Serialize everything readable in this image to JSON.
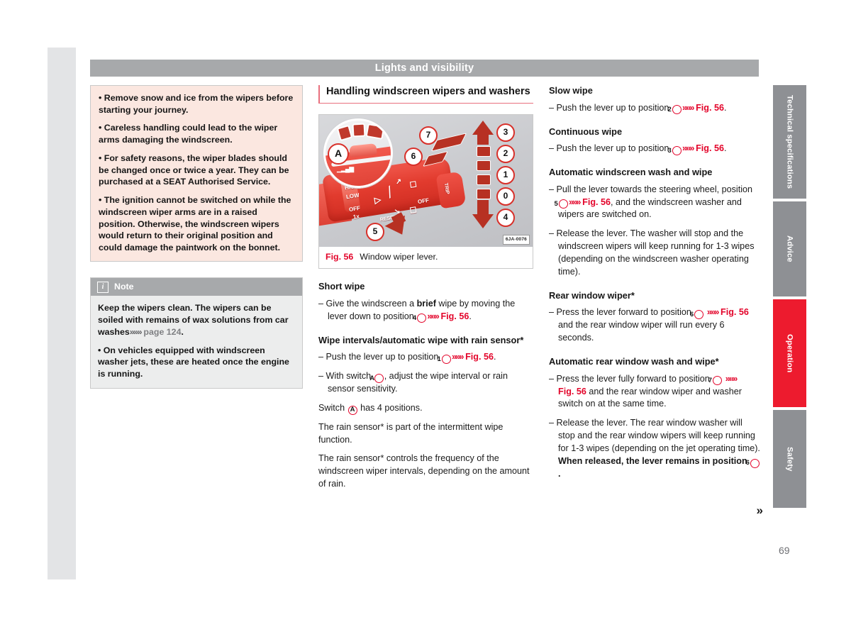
{
  "header": {
    "title": "Lights and visibility"
  },
  "page": {
    "number": "69",
    "continuation": "»"
  },
  "warning": {
    "items": [
      "• Remove snow and ice from the wipers before starting your journey.",
      "• Careless handling could lead to the wiper arms damaging the windscreen.",
      "• For safety reasons, the wiper blades should be changed once or twice a year. They can be purchased at a SEAT Authorised Service.",
      "• The ignition cannot be switched on while the windscreen wiper arms are in a raised position. Otherwise, the windscreen wipers would return to their original position and could damage the paintwork on the bonnet."
    ]
  },
  "note": {
    "icon": "info-icon",
    "title": "Note",
    "para1_a": "Keep the wipers clean. The wipers can be soiled with remains of wax solutions from car washes",
    "para1_chev": "»»»",
    "para1_ref": "page 124",
    "para1_end": ".",
    "para2": "• On vehicles equipped with windscreen washer jets, these are heated once the engine is running."
  },
  "section": {
    "heading": "Handling windscreen wipers and washers"
  },
  "figure": {
    "number": "Fig. 56",
    "caption": "Window wiper lever.",
    "image_code": "6JA-0076",
    "callouts": [
      "A",
      "7",
      "6",
      "5",
      "3",
      "2",
      "1",
      "0",
      "4"
    ],
    "lever_labels": [
      "HIGH",
      "LOW",
      "OFF",
      "1x",
      "RESET",
      "OFF",
      "TRIP"
    ]
  },
  "middle": {
    "short_wipe": {
      "heading": "Short wipe",
      "line_a": "– Give the windscreen a ",
      "line_bold": "brief",
      "line_b": " wipe by moving the lever down to position ",
      "callout": "4",
      "chev": "»»»",
      "ref": "Fig. 56",
      "end": "."
    },
    "intervals": {
      "heading": "Wipe intervals/automatic wipe with rain sensor*",
      "bullet1_a": "– Push the lever up to position ",
      "bullet1_callout": "1",
      "bullet1_chev": "»»»",
      "bullet1_ref": "Fig. 56",
      "bullet1_end": ".",
      "bullet2_a": "– With switch ",
      "bullet2_callout": "A",
      "bullet2_b": ", adjust the wipe interval or rain sensor sensitivity.",
      "para1_a": "Switch ",
      "para1_callout": "A",
      "para1_b": " has 4 positions.",
      "para2": "The rain sensor* is part of the intermittent wipe function.",
      "para3": "The rain sensor* controls the frequency of the windscreen wiper intervals, depending on the amount of rain."
    }
  },
  "right": {
    "slow_wipe": {
      "heading": "Slow wipe",
      "line_a": "– Push the lever up to position ",
      "callout": "2",
      "chev": "»»»",
      "ref": "Fig. 56",
      "end": "."
    },
    "continuous_wipe": {
      "heading": "Continuous wipe",
      "line_a": "– Push the lever up to position ",
      "callout": "3",
      "chev": "»»»",
      "ref": "Fig. 56",
      "end": "."
    },
    "auto_wash": {
      "heading": "Automatic windscreen wash and wipe",
      "b1_a": "– Pull the lever towards the steering wheel, position ",
      "b1_callout": "5",
      "b1_chev": "»»»",
      "b1_ref": "Fig. 56",
      "b1_b": ", and the windscreen washer and wipers are switched on.",
      "b2": "– Release the lever. The washer will stop and the windscreen wipers will keep running for 1-3 wipes (depending on the windscreen washer operating time)."
    },
    "rear_wiper": {
      "heading": "Rear window wiper*",
      "b1_a": "– Press the lever forward to position ",
      "b1_callout": "6",
      "b1_chev": "»»»",
      "b1_ref": "Fig. 56",
      "b1_b": " and the rear window wiper will run every 6 seconds."
    },
    "auto_rear": {
      "heading": "Automatic rear window wash and wipe*",
      "b1_a": "– Press the lever fully forward to position ",
      "b1_callout": "7",
      "b1_chev": "»»»",
      "b1_ref": "Fig. 56",
      "b1_b": " and the rear window wiper and washer switch on at the same time.",
      "b2_a": "– Release the lever. The rear window washer will stop and the rear window wipers will keep running for 1-3 wipes (depending on the jet operating time). ",
      "b2_bold": "When released, the lever remains in position ",
      "b2_callout": "6",
      "b2_end": "."
    }
  },
  "sidebar": {
    "tabs": [
      {
        "label": "Technical specifications",
        "active": false
      },
      {
        "label": "Advice",
        "active": false
      },
      {
        "label": "Operation",
        "active": true
      },
      {
        "label": "Safety",
        "active": false
      }
    ],
    "active_color": "#ed1b2e",
    "inactive_color": "#8e9094"
  }
}
